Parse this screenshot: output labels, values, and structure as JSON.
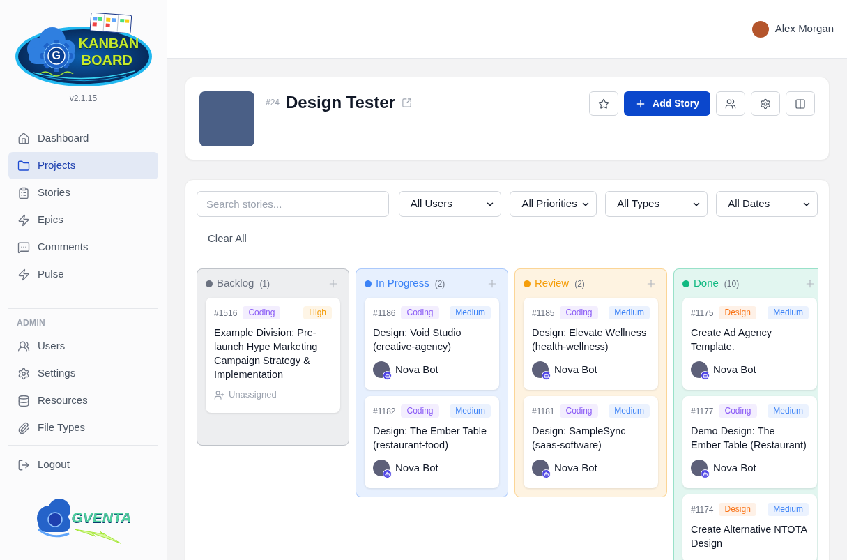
{
  "sidebar": {
    "logo": {
      "badge": "G",
      "line_1": "KANBAN",
      "line_2": "BOARD"
    },
    "version": "v2.1.15",
    "nav": [
      {
        "label": "Dashboard",
        "selected": false
      },
      {
        "label": "Projects",
        "selected": true
      },
      {
        "label": "Stories",
        "selected": false
      },
      {
        "label": "Epics",
        "selected": false
      },
      {
        "label": "Comments",
        "selected": false
      },
      {
        "label": "Pulse",
        "selected": false
      }
    ],
    "admin": {
      "heading": "ADMIN",
      "items": [
        {
          "label": "Users",
          "selected": false
        },
        {
          "label": "Settings",
          "selected": false
        },
        {
          "label": "Resources",
          "selected": false
        },
        {
          "label": "File Types",
          "selected": false
        }
      ]
    },
    "logout": {
      "label": "Logout"
    },
    "footer_logo": {
      "text": "GVENTA"
    }
  },
  "top_bar": {
    "user": {
      "name": "Alex Morgan"
    }
  },
  "project": {
    "number": "#24",
    "title": "Design Tester",
    "actions": [
      {
        "kind": "icon"
      },
      {
        "kind": "primary",
        "label": "Add Story"
      },
      {
        "kind": "icon"
      },
      {
        "kind": "icon"
      },
      {
        "kind": "icon"
      }
    ]
  },
  "filters": {
    "search": {
      "placeholder": "Search stories..."
    },
    "selects": [
      {
        "value": "All Users"
      },
      {
        "value": "All Priorities"
      },
      {
        "value": "All Types"
      },
      {
        "value": "All Dates"
      }
    ],
    "clear_button": "Clear All"
  },
  "columns": [
    {
      "title": "Backlog",
      "count": "(1)",
      "color": "#6b7280",
      "cards": [
        {
          "id": "#1516",
          "type": {
            "label": "Coding",
            "color": "#8b5cf6"
          },
          "priority": {
            "label": "High",
            "color": "#f59e0b"
          },
          "title": "Example Division: Pre-launch Hype Marketing Campaign Strategy & Implementation",
          "assignee": {
            "kind": "none",
            "label": "Unassigned"
          }
        }
      ]
    },
    {
      "title": "In Progress",
      "count": "(2)",
      "color": "#3b82f6",
      "cards": [
        {
          "id": "#1186",
          "type": {
            "label": "Coding",
            "color": "#8b5cf6"
          },
          "priority": {
            "label": "Medium",
            "color": "#3b82f6"
          },
          "title": "Design: Void Studio (creative-agency)",
          "assignee": {
            "kind": "bot",
            "name": "Nova Bot"
          }
        },
        {
          "id": "#1182",
          "type": {
            "label": "Coding",
            "color": "#8b5cf6"
          },
          "priority": {
            "label": "Medium",
            "color": "#3b82f6"
          },
          "title": "Design: The Ember Table (restaurant-food)",
          "assignee": {
            "kind": "bot",
            "name": "Nova Bot"
          }
        }
      ]
    },
    {
      "title": "Review",
      "count": "(2)",
      "color": "#f59e0b",
      "cards": [
        {
          "id": "#1185",
          "type": {
            "label": "Coding",
            "color": "#8b5cf6"
          },
          "priority": {
            "label": "Medium",
            "color": "#3b82f6"
          },
          "title": "Design: Elevate Wellness (health-wellness)",
          "assignee": {
            "kind": "bot",
            "name": "Nova Bot"
          }
        },
        {
          "id": "#1181",
          "type": {
            "label": "Coding",
            "color": "#8b5cf6"
          },
          "priority": {
            "label": "Medium",
            "color": "#3b82f6"
          },
          "title": "Design: SampleSync (saas-software)",
          "assignee": {
            "kind": "bot",
            "name": "Nova Bot"
          }
        }
      ]
    },
    {
      "title": "Done",
      "count": "(10)",
      "color": "#10b981",
      "cards": [
        {
          "id": "#1175",
          "type": {
            "label": "Design",
            "color": "#f97316"
          },
          "priority": {
            "label": "Medium",
            "color": "#3b82f6"
          },
          "title": "Create Ad Agency Template.",
          "assignee": {
            "kind": "bot",
            "name": "Nova Bot"
          }
        },
        {
          "id": "#1177",
          "type": {
            "label": "Coding",
            "color": "#8b5cf6"
          },
          "priority": {
            "label": "Medium",
            "color": "#3b82f6"
          },
          "title": "Demo Design: The Ember Table (Restaurant)",
          "assignee": {
            "kind": "bot",
            "name": "Nova Bot"
          }
        },
        {
          "id": "#1174",
          "type": {
            "label": "Design",
            "color": "#f97316"
          },
          "priority": {
            "label": "Medium",
            "color": "#3b82f6"
          },
          "title": "Create Alternative NTOTA Design"
        }
      ]
    }
  ]
}
